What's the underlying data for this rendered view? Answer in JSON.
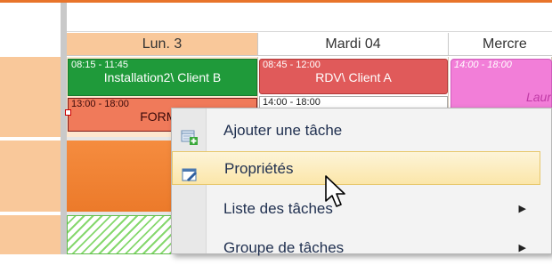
{
  "calendar": {
    "days": [
      {
        "label": "Lun. 3"
      },
      {
        "label": "Mardi 04"
      },
      {
        "label": "Mercre"
      }
    ],
    "appointments": [
      {
        "time": "08:15 - 11:45",
        "title": "Installation2\\ Client B",
        "color": "#1f9a3a"
      },
      {
        "time": "13:00 - 18:00",
        "title": "FORMA",
        "color": "#f07a5a"
      },
      {
        "time": "08:45 - 12:00",
        "title": "RDV\\ Client A",
        "color": "#e05a5a"
      },
      {
        "time": "14:00 - 18:00",
        "title": "",
        "color": "#ffffff"
      },
      {
        "time": "14:00 - 18:00",
        "title": "Laur",
        "color": "#f27ed8"
      }
    ]
  },
  "context_menu": {
    "items": [
      {
        "label": "Ajouter une tâche",
        "icon": "add-task-icon"
      },
      {
        "label": "Propriétés",
        "icon": "edit-properties-icon",
        "highlighted": true
      },
      {
        "label": "Liste des tâches",
        "submenu": true
      },
      {
        "label": "Groupe de tâches",
        "submenu": true
      }
    ]
  },
  "colors": {
    "accent_orange": "#e8742a",
    "today_header": "#f9c89a",
    "menu_highlight": "#fbe6a9"
  }
}
